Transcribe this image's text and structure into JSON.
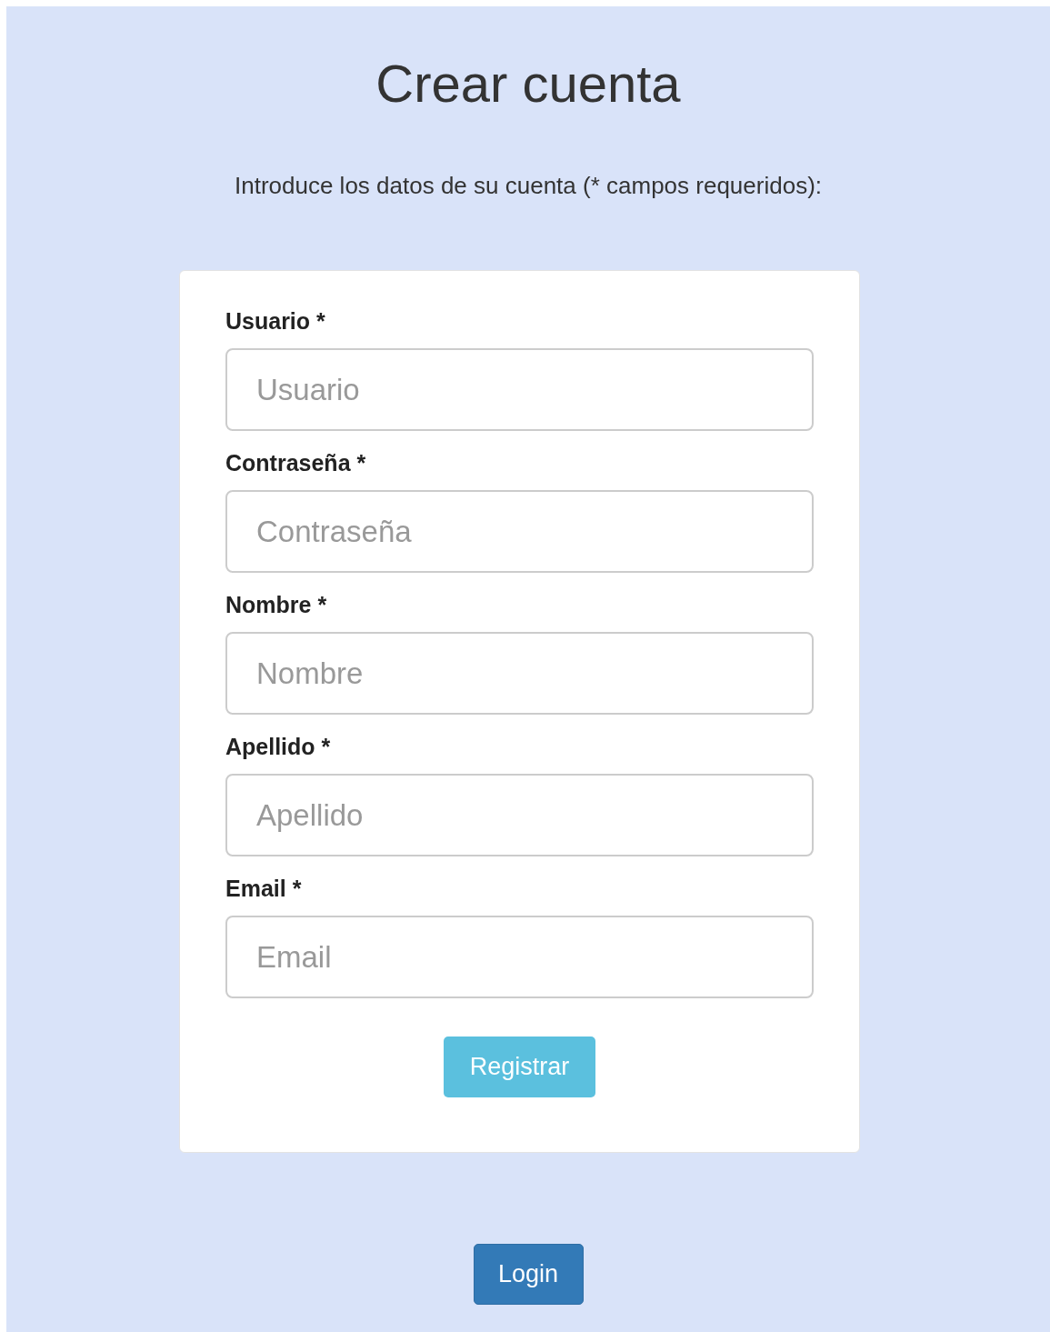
{
  "title": "Crear cuenta",
  "intro": "Introduce los datos de su cuenta (* campos requeridos):",
  "fields": [
    {
      "label": "Usuario *",
      "placeholder": "Usuario"
    },
    {
      "label": "Contraseña *",
      "placeholder": "Contraseña"
    },
    {
      "label": "Nombre *",
      "placeholder": "Nombre"
    },
    {
      "label": "Apellido *",
      "placeholder": "Apellido"
    },
    {
      "label": "Email *",
      "placeholder": "Email"
    }
  ],
  "submit": "Registrar",
  "login": "Login"
}
